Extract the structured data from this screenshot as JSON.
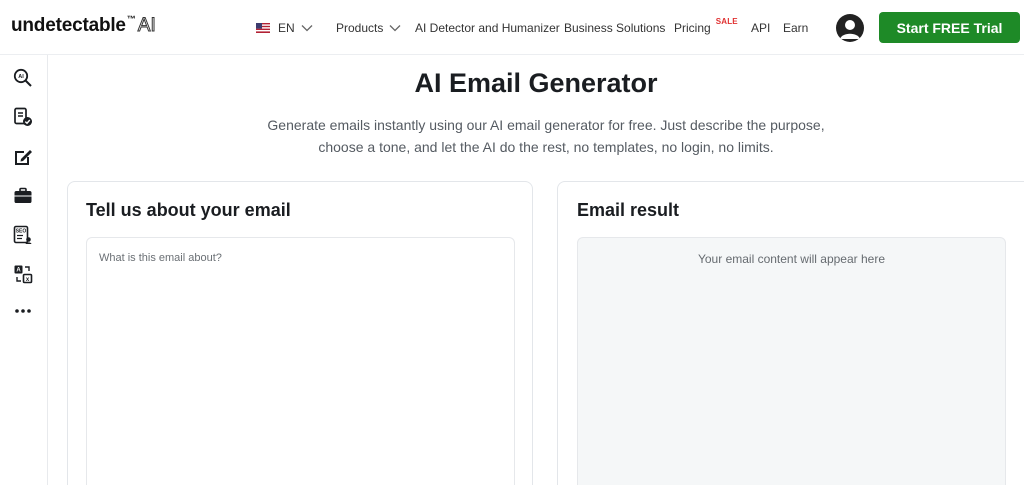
{
  "header": {
    "logo_word": "undetectable",
    "logo_tm": "™",
    "logo_ai": "AI",
    "lang": "EN",
    "nav": {
      "products": "Products",
      "detector": "AI Detector and Humanizer",
      "business": "Business Solutions",
      "pricing": "Pricing",
      "sale_badge": "SALE",
      "api": "API",
      "earn": "Earn"
    },
    "cta": "Start FREE Trial",
    "cta_color": "#1e8a27"
  },
  "sidebar": {
    "icons": [
      "ai-detector-icon",
      "checklist-icon",
      "edit-note-icon",
      "briefcase-icon",
      "seo-icon",
      "translate-icon",
      "more-icon"
    ]
  },
  "main": {
    "title": "AI Email Generator",
    "subtitle_line1": "Generate emails instantly using our AI email generator for free. Just describe the purpose,",
    "subtitle_line2": "choose a tone, and let the AI do the rest, no templates, no login, no limits."
  },
  "input_card": {
    "title": "Tell us about your email",
    "placeholder": "What is this email about?",
    "value": ""
  },
  "result_card": {
    "title": "Email result",
    "placeholder": "Your email content will appear here"
  }
}
